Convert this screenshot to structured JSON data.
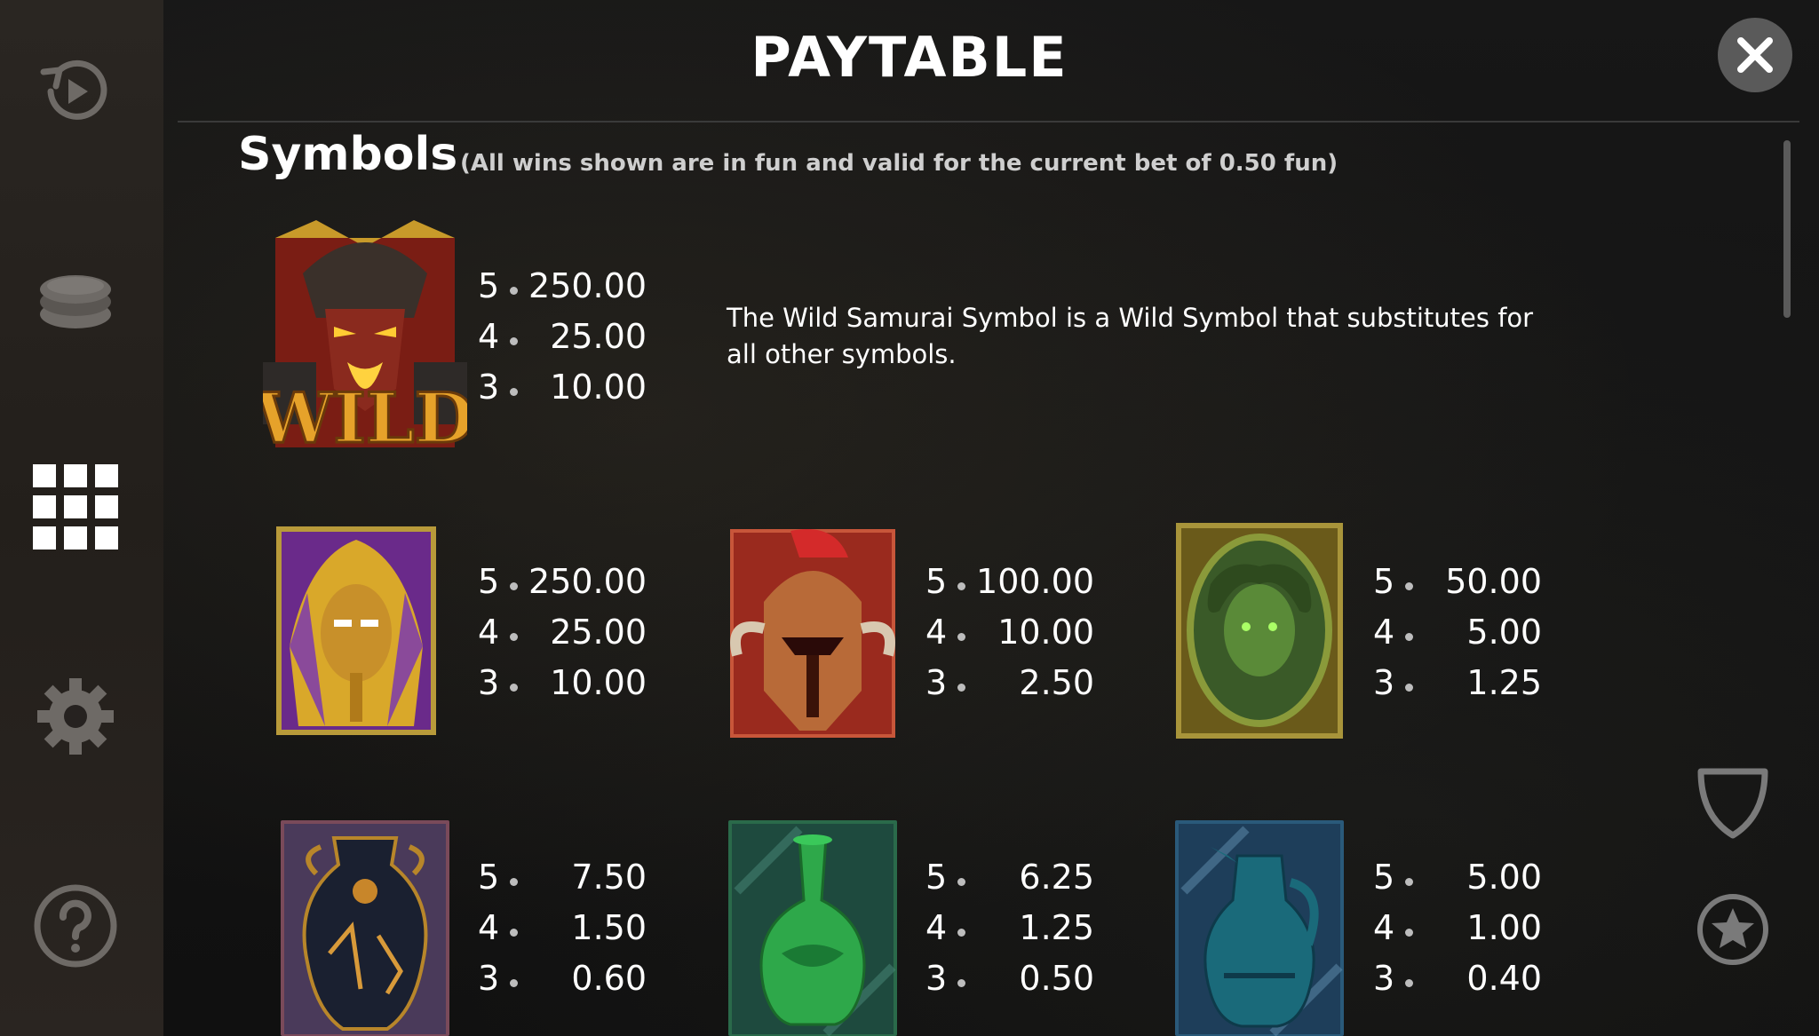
{
  "header": {
    "title": "PAYTABLE",
    "close_icon": "close-icon"
  },
  "sidebar": {
    "items": [
      {
        "name": "autoplay",
        "icon": "autoplay-icon"
      },
      {
        "name": "bet",
        "icon": "coins-icon"
      },
      {
        "name": "paytable",
        "icon": "grid-icon",
        "active": true
      },
      {
        "name": "settings",
        "icon": "gear-icon"
      },
      {
        "name": "help",
        "icon": "question-icon"
      }
    ]
  },
  "section": {
    "title": "Symbols",
    "note": "(All wins shown are in fun and valid for the current bet of 0.50 fun)"
  },
  "symbols": [
    {
      "id": "wild-samurai",
      "icon": "samurai-wild-icon",
      "pays": [
        {
          "count": "5",
          "value": "250.00"
        },
        {
          "count": "4",
          "value": "25.00"
        },
        {
          "count": "3",
          "value": "10.00"
        }
      ],
      "description": "The Wild Samurai Symbol is a Wild Symbol that substitutes for all other symbols."
    },
    {
      "id": "pharaoh",
      "icon": "pharaoh-icon",
      "pays": [
        {
          "count": "5",
          "value": "250.00"
        },
        {
          "count": "4",
          "value": "25.00"
        },
        {
          "count": "3",
          "value": "10.00"
        }
      ]
    },
    {
      "id": "spartan-helmet",
      "icon": "helmet-icon",
      "pays": [
        {
          "count": "5",
          "value": "100.00"
        },
        {
          "count": "4",
          "value": "10.00"
        },
        {
          "count": "3",
          "value": "2.50"
        }
      ]
    },
    {
      "id": "medusa",
      "icon": "medusa-shield-icon",
      "pays": [
        {
          "count": "5",
          "value": "50.00"
        },
        {
          "count": "4",
          "value": "5.00"
        },
        {
          "count": "3",
          "value": "1.25"
        }
      ]
    },
    {
      "id": "amphora",
      "icon": "amphora-icon",
      "pays": [
        {
          "count": "5",
          "value": "7.50"
        },
        {
          "count": "4",
          "value": "1.50"
        },
        {
          "count": "3",
          "value": "0.60"
        }
      ]
    },
    {
      "id": "green-vase",
      "icon": "green-vase-icon",
      "pays": [
        {
          "count": "5",
          "value": "6.25"
        },
        {
          "count": "4",
          "value": "1.25"
        },
        {
          "count": "3",
          "value": "0.50"
        }
      ]
    },
    {
      "id": "blue-jug",
      "icon": "blue-jug-icon",
      "pays": [
        {
          "count": "5",
          "value": "5.00"
        },
        {
          "count": "4",
          "value": "1.00"
        },
        {
          "count": "3",
          "value": "0.40"
        }
      ]
    }
  ],
  "right_controls": [
    {
      "name": "shield",
      "icon": "shield-icon"
    },
    {
      "name": "favorite",
      "icon": "star-icon"
    }
  ],
  "colors": {
    "background": "#121212",
    "sidebar": "#262220",
    "close_button": "#5a5a5a",
    "text": "#ffffff"
  }
}
